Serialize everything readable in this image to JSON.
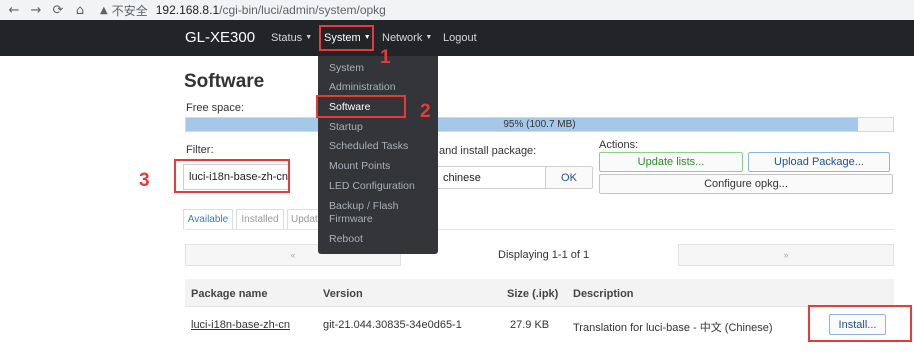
{
  "browser": {
    "back_icon": "←",
    "forward_icon": "→",
    "reload_icon": "⟳",
    "home_icon": "⌂",
    "warning_icon": "▲",
    "insecure_label": "不安全",
    "url_host": "192.168.8.1",
    "url_path": "/cgi-bin/luci/admin/system/opkg"
  },
  "navbar": {
    "brand": "GL-XE300",
    "items": [
      {
        "label": "Status",
        "caret": "▼"
      },
      {
        "label": "System",
        "caret": "▼"
      },
      {
        "label": "Network",
        "caret": "▼"
      },
      {
        "label": "Logout"
      }
    ]
  },
  "system_menu": {
    "items": [
      "System",
      "Administration",
      "Software",
      "Startup",
      "Scheduled Tasks",
      "Mount Points",
      "LED Configuration",
      "Backup / Flash",
      "Firmware",
      "Reboot"
    ],
    "active": "Software"
  },
  "page": {
    "title": "Software",
    "free_space_label": "Free space:",
    "free_space_percent": 95,
    "free_space_text": "95% (100.7 MB)",
    "filter_label": "Filter:",
    "filter_value": "luci-i18n-base-zh-cn",
    "download_label": "and install package:",
    "download_value": "chinese",
    "ok_label": "OK",
    "actions_label": "Actions:",
    "update_lists": "Update lists...",
    "upload_package": "Upload Package...",
    "configure_opkg": "Configure opkg..."
  },
  "tabs": [
    "Available",
    "Installed",
    "Updat"
  ],
  "pager": {
    "prev": "«",
    "next": "»",
    "status": "Displaying 1-1 of 1"
  },
  "table": {
    "columns": [
      "Package name",
      "Version",
      "Size (.ipk)",
      "Description"
    ],
    "rows": [
      {
        "name": "luci-i18n-base-zh-cn",
        "version": "git-21.044.30835-34e0d65-1",
        "size": "27.9 KB",
        "description": "Translation for luci-base - 中文 (Chinese)",
        "action": "Install..."
      }
    ]
  },
  "annotations": [
    "1",
    "2",
    "3"
  ],
  "colors": {
    "navbar_bg": "#222428",
    "dropdown_bg": "#333538",
    "progress_fill": "#a6c8e8",
    "annotation_red": "#e53b3b"
  }
}
